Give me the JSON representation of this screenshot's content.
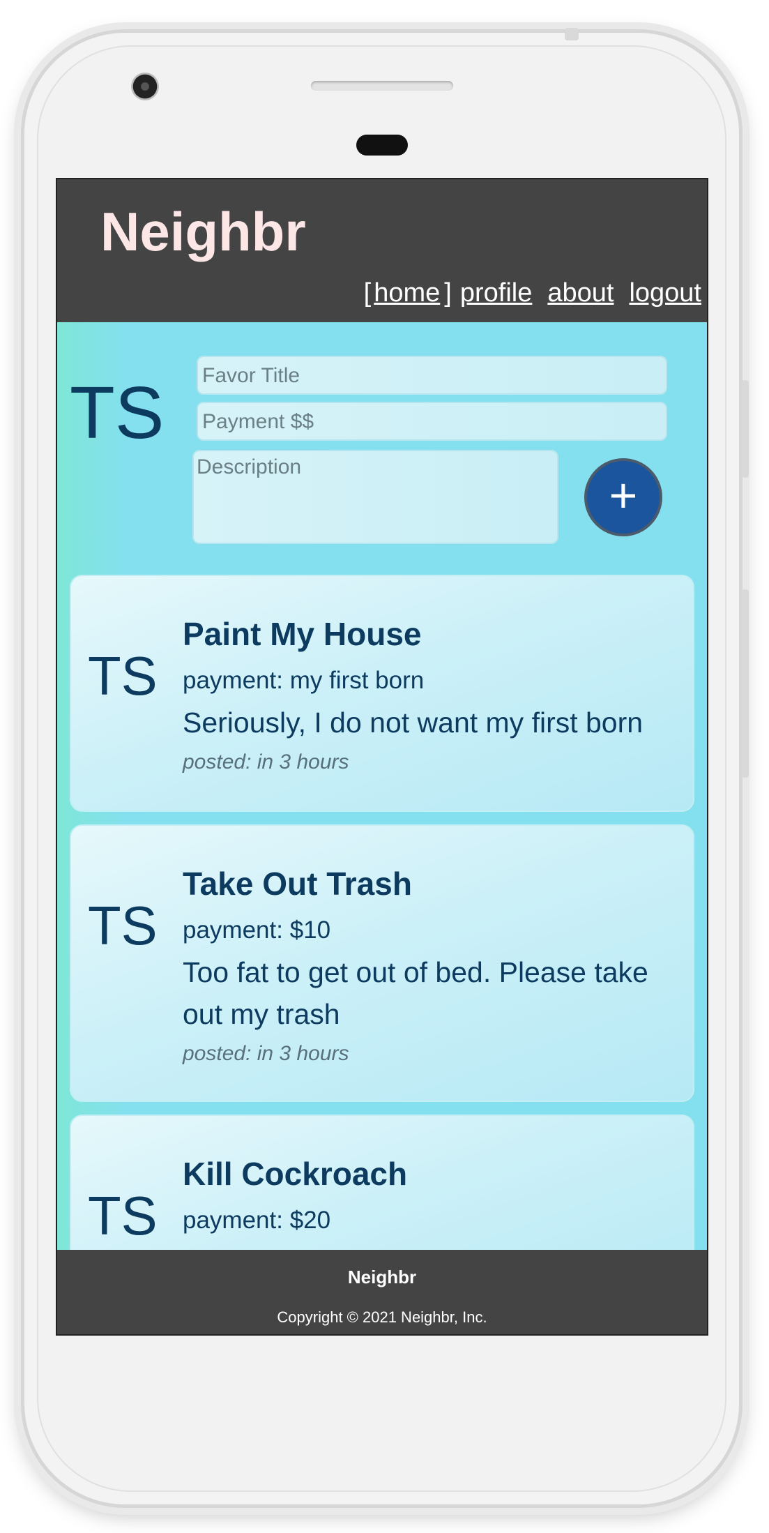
{
  "app": {
    "brand": "Neighbr"
  },
  "nav": {
    "open_bracket": "[",
    "close_bracket": "]",
    "home": "home",
    "profile": "profile",
    "about": "about",
    "logout": "logout"
  },
  "compose": {
    "avatar_initials": "TS",
    "title_placeholder": "Favor Title",
    "payment_placeholder": "Payment $$",
    "description_placeholder": "Description",
    "add_button_label": "+"
  },
  "favors": [
    {
      "initials": "TS",
      "title": "Paint My House",
      "payment": "payment: my first born",
      "description": "Seriously, I do not want my first born",
      "posted": "posted: in 3 hours"
    },
    {
      "initials": "TS",
      "title": "Take Out Trash",
      "payment": "payment: $10",
      "description": "Too fat to get out of bed. Please take out my trash",
      "posted": "posted: in 3 hours"
    },
    {
      "initials": "TS",
      "title": "Kill Cockroach",
      "payment": "payment: $20"
    }
  ],
  "footer": {
    "name": "Neighbr",
    "copyright": "Copyright © 2021 Neighbr, Inc."
  },
  "colors": {
    "header_bg": "#444444",
    "brand_text": "#fde6e6",
    "accent_button": "#1b559d",
    "text_dark": "#0d3b5f",
    "page_bg": "#84e0ee"
  }
}
